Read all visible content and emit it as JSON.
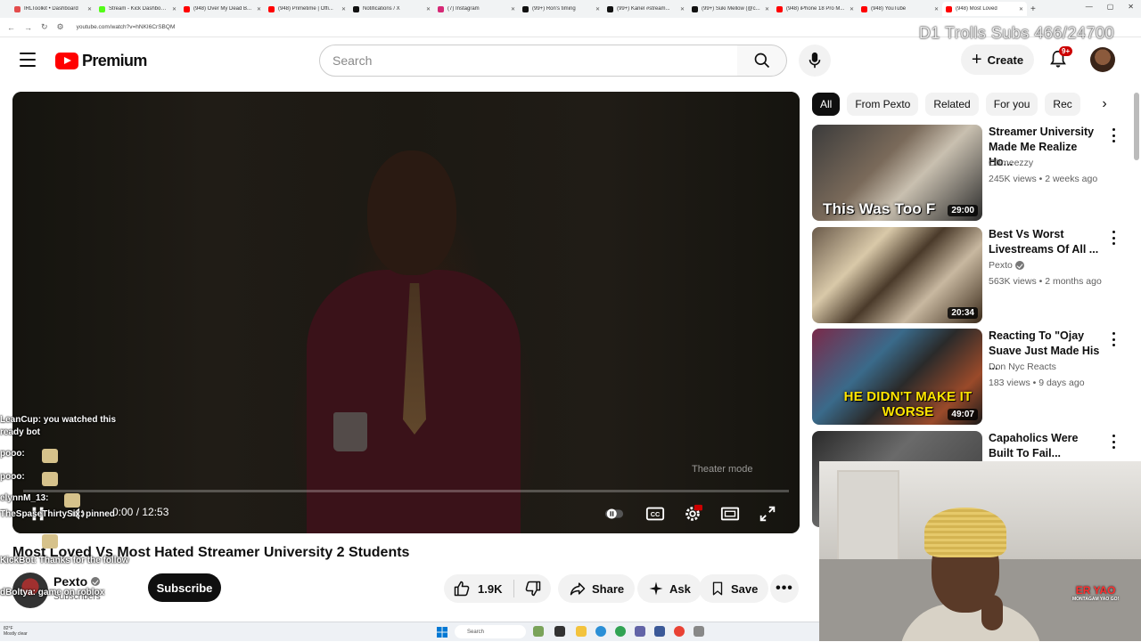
{
  "browser": {
    "tabs": [
      {
        "label": "IRLToolkit • Dashboard",
        "color": "#e34c4c",
        "active": false
      },
      {
        "label": "Stream - Kick Dashboard",
        "color": "#53fc18",
        "active": false
      },
      {
        "label": "(948) Over My Dead B...",
        "color": "#ff0000",
        "active": false
      },
      {
        "label": "(948) Primetime | Offi...",
        "color": "#ff0000",
        "active": false
      },
      {
        "label": "Notifications / X",
        "color": "#111111",
        "active": false
      },
      {
        "label": "(7) Instagram",
        "color": "#d62976",
        "active": false
      },
      {
        "label": "(99+) Ron's timing",
        "color": "#111111",
        "active": false
      },
      {
        "label": "(99+) Kanel #stream...",
        "color": "#111111",
        "active": false
      },
      {
        "label": "(99+) Suki Mellow (@c...",
        "color": "#111111",
        "active": false
      },
      {
        "label": "(948) iPhone 18 Pro M...",
        "color": "#ff0000",
        "active": false
      },
      {
        "label": "(948) YouTube",
        "color": "#ff0000",
        "active": false
      },
      {
        "label": "(948) Most Loved",
        "color": "#ff0000",
        "active": true
      }
    ],
    "url": "youtube.com/watch?v=hNKI6CrSBQM"
  },
  "stream_overlay_text": "D1 Trolls Subs 466/24700",
  "masthead": {
    "logo_text": "Premium",
    "search_placeholder": "Search",
    "create_label": "Create",
    "notification_count": "9+"
  },
  "player": {
    "time": "0:00 / 12:53",
    "theater_label": "Theater mode",
    "progress": 0.0
  },
  "video": {
    "title": "Most Loved Vs Most Hated Streamer University 2 Students",
    "channel": "Pexto",
    "subscribers": "Subscribers",
    "subscribe_label": "Subscribe",
    "likes": "1.9K",
    "share_label": "Share",
    "ask_label": "Ask",
    "save_label": "Save"
  },
  "chat": [
    {
      "user": "LeanCup:",
      "msg": "you watched this"
    },
    {
      "user": "",
      "msg": "ready bot"
    },
    {
      "user": "pooo:",
      "msg": ""
    },
    {
      "user": "pooo:",
      "msg": ""
    },
    {
      "user": "elynnM_13:",
      "msg": ""
    },
    {
      "user": "TheSpaseThirtySix:",
      "msg": "pinned"
    },
    {
      "user": "KickBot:",
      "msg": "Thanks for the follow"
    },
    {
      "user": "dBoltya:",
      "msg": "game on roblox"
    }
  ],
  "chips": [
    {
      "label": "All",
      "active": true
    },
    {
      "label": "From Pexto",
      "active": false
    },
    {
      "label": "Related",
      "active": false
    },
    {
      "label": "For you",
      "active": false
    },
    {
      "label": "Rec",
      "active": false
    }
  ],
  "recommendations": [
    {
      "title": "Streamer University Made Me Realize Ho...",
      "channel": "Ohmeezzy",
      "verified": false,
      "meta": "245K views • 2 weeks ago",
      "duration": "29:00",
      "caption": "This Was Too F"
    },
    {
      "title": "Best Vs Worst Livestreams Of All ...",
      "channel": "Pexto",
      "verified": true,
      "meta": "563K views • 2 months ago",
      "duration": "20:34",
      "caption": ""
    },
    {
      "title": "Reacting To \"Ojay Suave Just Made His ...",
      "channel": "Don Nyc Reacts",
      "verified": false,
      "meta": "183 views • 9 days ago",
      "duration": "49:07",
      "caption": "HE DIDN'T MAKE IT WORSE"
    },
    {
      "title": "Capaholics Were Built To Fail...",
      "channel": "",
      "verified": false,
      "meta": "",
      "duration": "",
      "caption": ""
    }
  ],
  "webcam_logo": "ER YAO",
  "webcam_logo_sub": "MONTAGAM YAO GO!",
  "taskbar": {
    "weather": "82°F\nMostly clear",
    "search_label": "Search"
  }
}
